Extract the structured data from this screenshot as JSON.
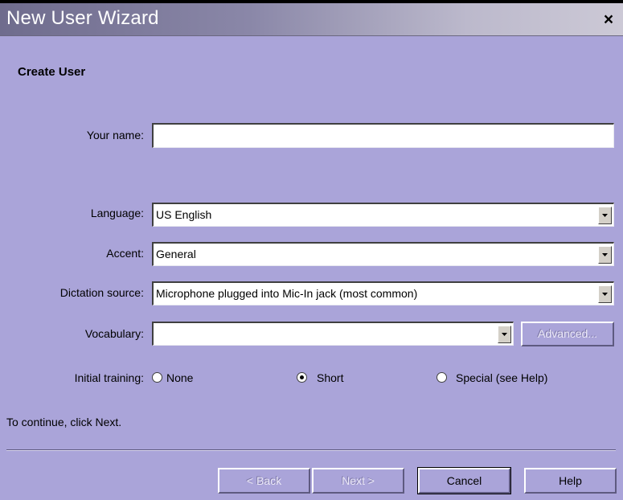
{
  "window": {
    "title": "New User Wizard",
    "close_glyph": "×"
  },
  "page": {
    "heading": "Create User"
  },
  "form": {
    "name_label": "Your name:",
    "name_value": "",
    "language_label": "Language:",
    "language_value": "US English",
    "accent_label": "Accent:",
    "accent_value": "General",
    "dictation_label": "Dictation source:",
    "dictation_value": "Microphone plugged into Mic-In jack (most common)",
    "vocabulary_label": "Vocabulary:",
    "vocabulary_value": "",
    "advanced_label": "Advanced...",
    "training_label": "Initial training:",
    "training_options": [
      {
        "label": "None",
        "selected": false
      },
      {
        "label": "Short",
        "selected": true
      },
      {
        "label": "Special (see Help)",
        "selected": false
      }
    ]
  },
  "hint": "To continue, click Next.",
  "footer": {
    "back_label": "< Back",
    "next_label": "Next >",
    "cancel_label": "Cancel",
    "help_label": "Help"
  },
  "colors": {
    "background": "#aaa4d9",
    "title_text": "#ffffff"
  }
}
